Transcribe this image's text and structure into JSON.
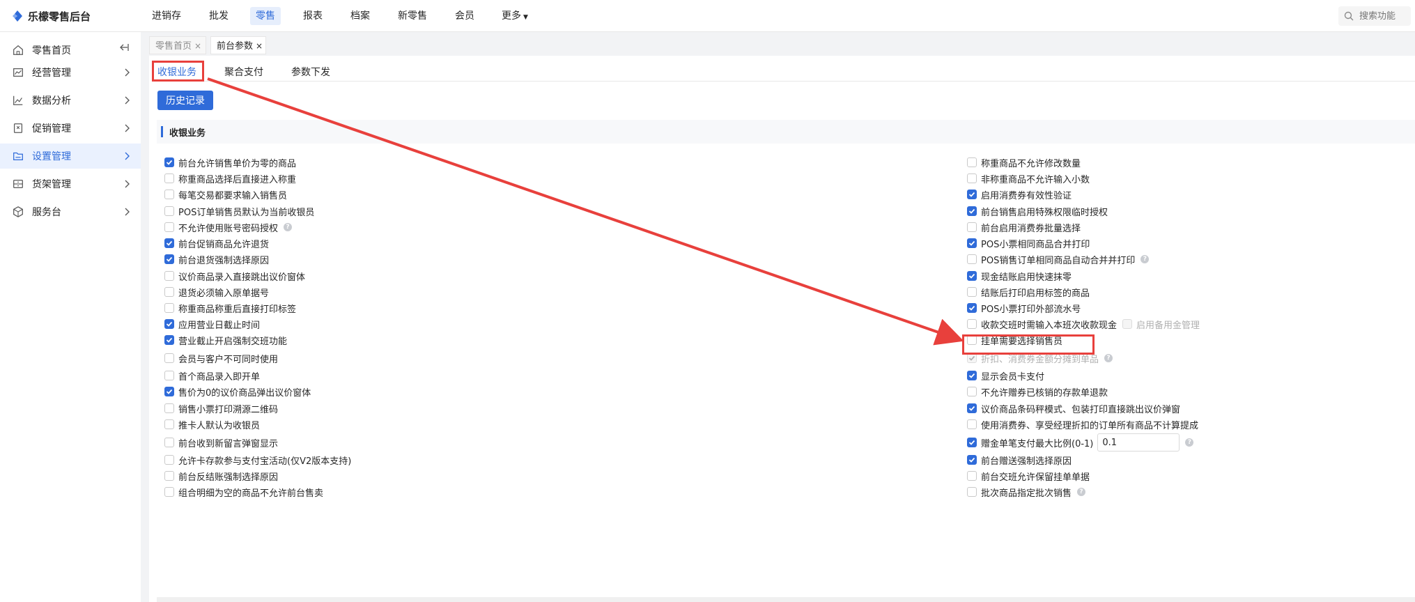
{
  "app": {
    "title": "乐檬零售后台"
  },
  "topnav": {
    "items": [
      "进销存",
      "批发",
      "零售",
      "报表",
      "档案",
      "新零售",
      "会员",
      "更多"
    ],
    "active_index": 2
  },
  "search": {
    "placeholder": "搜索功能"
  },
  "sidebar": {
    "items": [
      {
        "label": "零售首页",
        "icon": "home-icon"
      },
      {
        "label": "经营管理",
        "icon": "chart-box-icon"
      },
      {
        "label": "数据分析",
        "icon": "line-chart-icon"
      },
      {
        "label": "促销管理",
        "icon": "tag-icon"
      },
      {
        "label": "设置管理",
        "icon": "folder-icon"
      },
      {
        "label": "货架管理",
        "icon": "shelf-icon"
      },
      {
        "label": "服务台",
        "icon": "cube-icon"
      }
    ],
    "active_index": 4
  },
  "page_tabs": [
    {
      "label": "零售首页",
      "close": "×"
    },
    {
      "label": "前台参数",
      "close": "×"
    }
  ],
  "sub_tabs": [
    "收银业务",
    "聚合支付",
    "参数下发"
  ],
  "history_button": "历史记录",
  "section_title": "收银业务",
  "left_options": [
    {
      "label": "前台允许销售单价为零的商品",
      "checked": true
    },
    {
      "label": "称重商品选择后直接进入称重",
      "checked": false
    },
    {
      "label": "每笔交易都要求输入销售员",
      "checked": false
    },
    {
      "label": "POS订单销售员默认为当前收银员",
      "checked": false
    },
    {
      "label": "不允许使用账号密码授权",
      "checked": false,
      "help": true
    },
    {
      "label": "前台促销商品允许退货",
      "checked": true
    },
    {
      "label": "前台退货强制选择原因",
      "checked": true
    },
    {
      "label": "议价商品录入直接跳出议价窗体",
      "checked": false
    },
    {
      "label": "退货必须输入原单据号",
      "checked": false
    },
    {
      "label": "称重商品称重后直接打印标签",
      "checked": false
    },
    {
      "label": "应用营业日截止时间",
      "checked": true
    },
    {
      "label": "营业截止开启强制交班功能",
      "checked": true
    },
    {
      "label": "会员与客户不可同时使用",
      "checked": false
    },
    {
      "label": "首个商品录入即开单",
      "checked": false
    },
    {
      "label": "售价为0的议价商品弹出议价窗体",
      "checked": true
    },
    {
      "label": "销售小票打印溯源二维码",
      "checked": false
    },
    {
      "label": "推卡人默认为收银员",
      "checked": false
    },
    {
      "label": "前台收到新留言弹窗显示",
      "checked": false
    },
    {
      "label": "允许卡存款参与支付宝活动(仅V2版本支持)",
      "checked": false
    },
    {
      "label": "前台反结账强制选择原因",
      "checked": false
    },
    {
      "label": "组合明细为空的商品不允许前台售卖",
      "checked": false
    }
  ],
  "right_options": [
    {
      "label": "称重商品不允许修改数量",
      "checked": false
    },
    {
      "label": "非称重商品不允许输入小数",
      "checked": false
    },
    {
      "label": "启用消费券有效性验证",
      "checked": true
    },
    {
      "label": "前台销售启用特殊权限临时授权",
      "checked": true
    },
    {
      "label": "前台启用消费券批量选择",
      "checked": false
    },
    {
      "label": "POS小票相同商品合并打印",
      "checked": true
    },
    {
      "label": "POS销售订单相同商品自动合并并打印",
      "checked": false,
      "help": true
    },
    {
      "label": "现金结账启用快速抹零",
      "checked": true
    },
    {
      "label": "结账后打印启用标签的商品",
      "checked": false
    },
    {
      "label": "POS小票打印外部流水号",
      "checked": true,
      "highlighted": true
    },
    {
      "label": "收款交班时需输入本班次收款现金",
      "checked": false,
      "extra": {
        "label": "启用备用金管理",
        "checked": false,
        "disabled": true
      }
    },
    {
      "label": "挂单需要选择销售员",
      "checked": false
    },
    {
      "label": "折扣、消费券金额分摊到单品",
      "checked": true,
      "disabled": true,
      "help": true
    },
    {
      "label": "显示会员卡支付",
      "checked": true
    },
    {
      "label": "不允许赠券已核销的存款单退款",
      "checked": false
    },
    {
      "label": "议价商品条码秤模式、包装打印直接跳出议价弹窗",
      "checked": true
    },
    {
      "label": "使用消费券、享受经理折扣的订单所有商品不计算提成",
      "checked": false
    },
    {
      "label": "赠金单笔支付最大比例(0-1)",
      "checked": true,
      "input_value": "0.1",
      "help": true
    },
    {
      "label": "前台赠送强制选择原因",
      "checked": true
    },
    {
      "label": "前台交班允许保留挂单单据",
      "checked": false
    },
    {
      "label": "批次商品指定批次销售",
      "checked": false,
      "help": true
    }
  ],
  "colors": {
    "accent": "#2f6bd9",
    "highlight_box": "#e8403c",
    "arrow": "#e8403c"
  }
}
